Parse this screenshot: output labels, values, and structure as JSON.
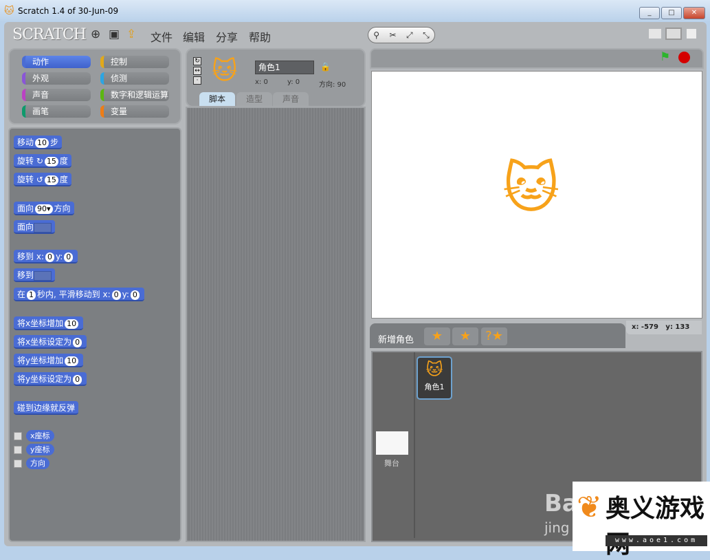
{
  "window": {
    "title": "Scratch 1.4 of 30-Jun-09",
    "min": "_",
    "max": "□",
    "close": "✕"
  },
  "toolbar": {
    "logo": "SCRATCH",
    "menus": [
      "文件",
      "编辑",
      "分享",
      "帮助"
    ]
  },
  "categories": [
    {
      "label": "动作",
      "color": "#4a6cd4"
    },
    {
      "label": "控制",
      "color": "#e1a91a"
    },
    {
      "label": "外观",
      "color": "#8a55d7"
    },
    {
      "label": "侦测",
      "color": "#2ca5e2"
    },
    {
      "label": "声音",
      "color": "#bb42c3"
    },
    {
      "label": "数字和逻辑运算",
      "color": "#5cb712"
    },
    {
      "label": "画笔",
      "color": "#0e9a6c"
    },
    {
      "label": "变量",
      "color": "#ee7d16"
    }
  ],
  "blocks": {
    "move": [
      "移动",
      "10",
      "步"
    ],
    "turn_cw": [
      "旋转",
      "↻",
      "15",
      "度"
    ],
    "turn_ccw": [
      "旋转",
      "↺",
      "15",
      "度"
    ],
    "point_dir": [
      "面向",
      "90▾",
      "方向"
    ],
    "point_to": "面向",
    "goto_xy": [
      "移到",
      "x:",
      "0",
      "y:",
      "0"
    ],
    "goto": "移到",
    "glide": [
      "在",
      "1",
      "秒内, 平滑移动到",
      "x:",
      "0",
      "y:",
      "0"
    ],
    "change_x": [
      "将x坐标增加",
      "10"
    ],
    "set_x": [
      "将x坐标设定为",
      "0"
    ],
    "change_y": [
      "将y坐标增加",
      "10"
    ],
    "set_y": [
      "将y坐标设定为",
      "0"
    ],
    "bounce": "碰到边缘就反弹",
    "reporters": [
      "x座标",
      "y座标",
      "方向"
    ]
  },
  "sprite": {
    "name": "角色1",
    "x": "x: 0",
    "y": "y: 0",
    "direction": "方向: 90"
  },
  "tabs": [
    "脚本",
    "造型",
    "声音"
  ],
  "stage": {
    "mouse_x": "x: -579",
    "mouse_y": "y: 133"
  },
  "sprite_panel": {
    "new_sprite": "新增角色",
    "sprites": [
      "角色1"
    ],
    "stage_label": "舞台"
  },
  "watermark": {
    "baidu": "Bai",
    "jing": "jing",
    "site": "奥义游戏网",
    "url": "www.aoe1.com"
  }
}
